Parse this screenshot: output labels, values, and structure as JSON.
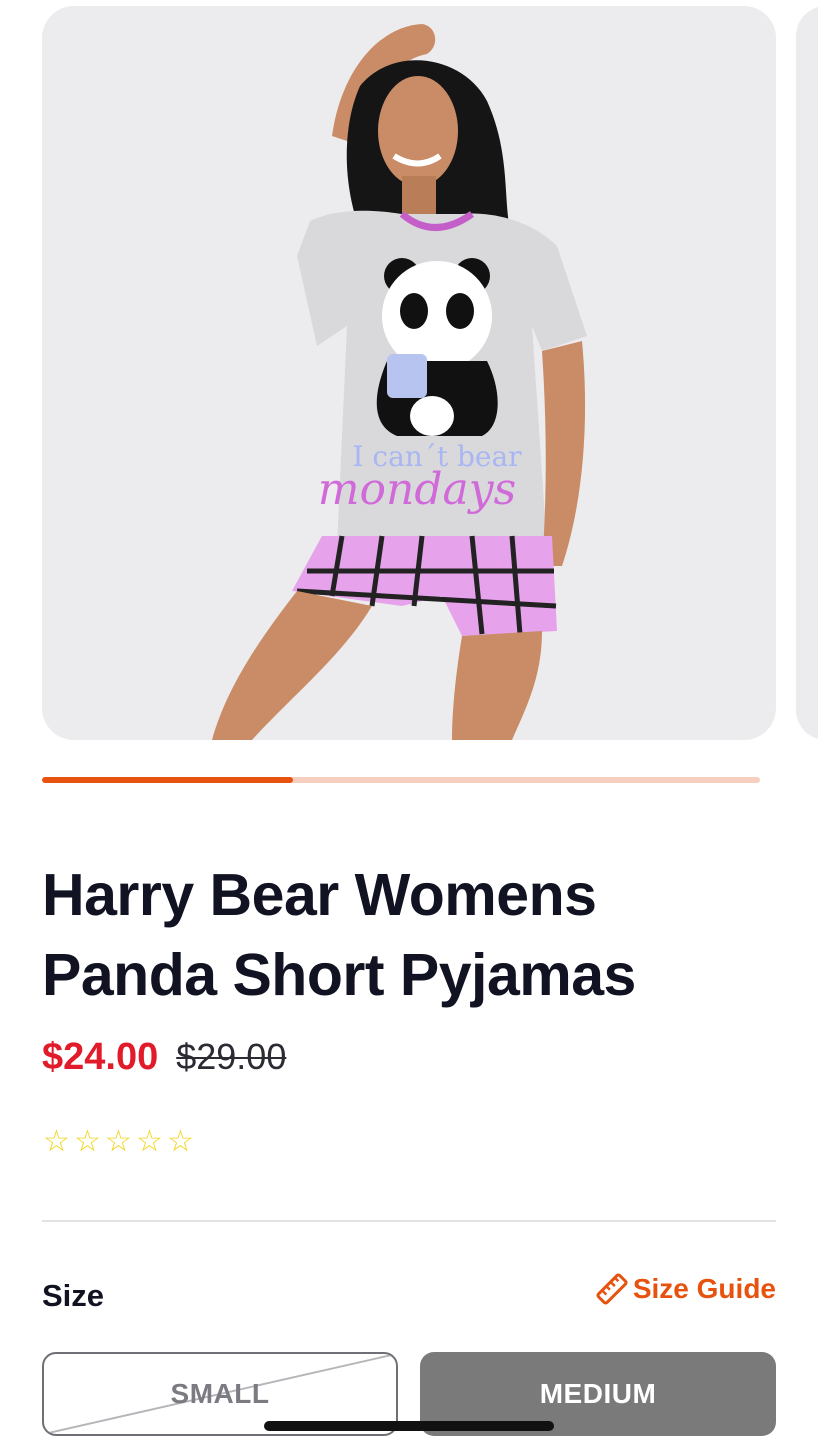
{
  "product": {
    "image_alt": "Model wearing grey panda t-shirt and pink checked shorts",
    "shirt_text_line1": "I can´t bear",
    "shirt_text_line2": "mondays",
    "title": "Harry Bear Womens Panda Short Pyjamas",
    "sale_price": "$24.00",
    "original_price": "$29.00",
    "rating": {
      "value": 0,
      "max": 5,
      "star_glyph": "☆",
      "color": "#f2d418"
    }
  },
  "gallery": {
    "progress_fraction": 0.35,
    "accent_color": "#e8520f"
  },
  "size": {
    "label": "Size",
    "guide_label": "Size Guide",
    "guide_icon": "ruler-icon",
    "options": [
      {
        "label": "SMALL",
        "state": "unavailable"
      },
      {
        "label": "MEDIUM",
        "state": "selected"
      }
    ]
  },
  "colors": {
    "sale": "#e11b2a",
    "accent": "#e8520f",
    "text": "#111322"
  }
}
